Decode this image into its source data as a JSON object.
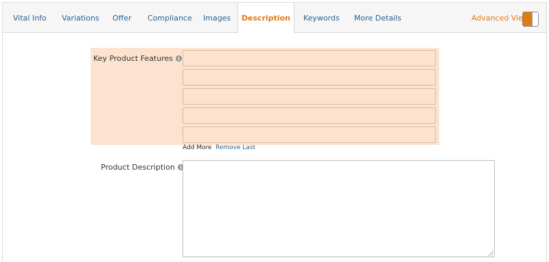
{
  "tabs": [
    {
      "label": "Vital Info",
      "active": false
    },
    {
      "label": "Variations",
      "active": false
    },
    {
      "label": "Offer",
      "active": false
    },
    {
      "label": "Compliance",
      "active": false
    },
    {
      "label": "Images",
      "active": false
    },
    {
      "label": "Description",
      "active": true
    },
    {
      "label": "Keywords",
      "active": false
    },
    {
      "label": "More Details",
      "active": false
    }
  ],
  "advanced_view": {
    "label": "Advanced View",
    "enabled": true
  },
  "key_features": {
    "label": "Key Product Features",
    "info_icon": "info-icon",
    "inputs": [
      "",
      "",
      "",
      "",
      ""
    ],
    "add_more": "Add More",
    "remove_last": "Remove Last"
  },
  "product_description": {
    "label": "Product Description",
    "info_icon": "info-icon",
    "value": ""
  },
  "colors": {
    "accent": "#e47911",
    "link": "#2b5f8e",
    "highlight": "#fde3cf"
  }
}
